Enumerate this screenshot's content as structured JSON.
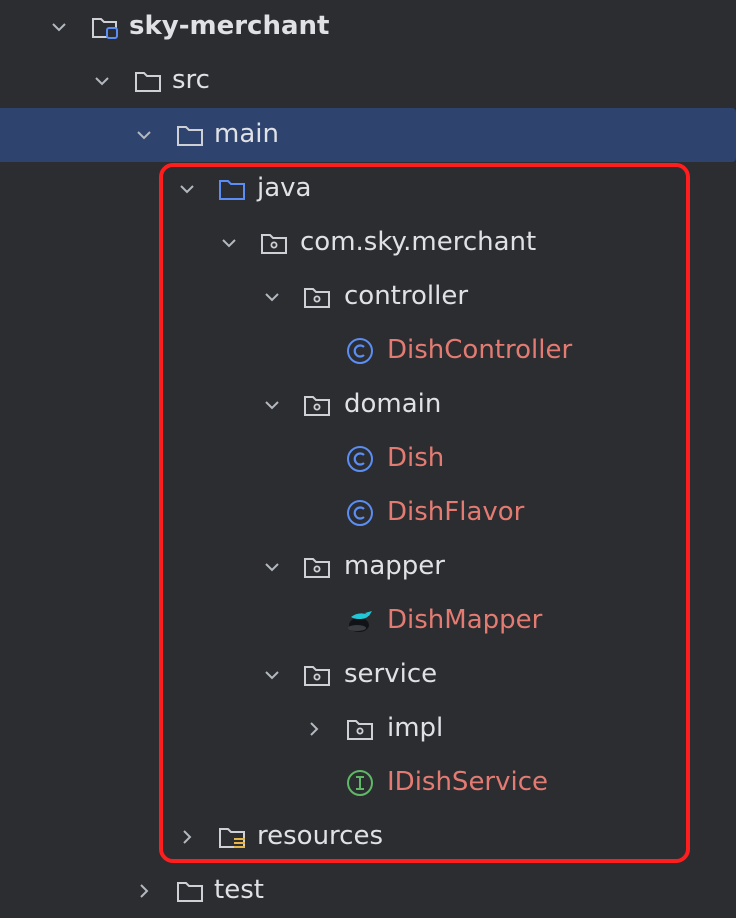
{
  "colors": {
    "background": "#2b2d30",
    "selection": "#2e436e",
    "text": "#dfe1e5",
    "modified_text": "#e37b72",
    "class_icon": "#5b8df5",
    "interface_icon": "#5fb865",
    "highlight_border": "#ff1e1e"
  },
  "tree": {
    "root": {
      "label": "sky-merchant",
      "icon": "module-folder-icon",
      "expanded": true
    },
    "src": {
      "label": "src",
      "icon": "folder-icon",
      "expanded": true
    },
    "main": {
      "label": "main",
      "icon": "folder-icon",
      "expanded": true,
      "selected": true
    },
    "java": {
      "label": "java",
      "icon": "source-root-folder-icon",
      "expanded": true
    },
    "pkg_root": {
      "label": "com.sky.merchant",
      "icon": "package-icon",
      "expanded": true
    },
    "controller": {
      "label": "controller",
      "icon": "package-icon",
      "expanded": true
    },
    "dish_controller": {
      "label": "DishController",
      "icon": "java-class-icon"
    },
    "domain": {
      "label": "domain",
      "icon": "package-icon",
      "expanded": true
    },
    "dish": {
      "label": "Dish",
      "icon": "java-class-icon"
    },
    "dish_flavor": {
      "label": "DishFlavor",
      "icon": "java-class-icon"
    },
    "mapper": {
      "label": "mapper",
      "icon": "package-icon",
      "expanded": true
    },
    "dish_mapper": {
      "label": "DishMapper",
      "icon": "mybatis-mapper-icon"
    },
    "service": {
      "label": "service",
      "icon": "package-icon",
      "expanded": true
    },
    "impl": {
      "label": "impl",
      "icon": "package-icon",
      "expanded": false
    },
    "idish_service": {
      "label": "IDishService",
      "icon": "java-interface-icon"
    },
    "resources": {
      "label": "resources",
      "icon": "resources-folder-icon",
      "expanded": false
    },
    "test": {
      "label": "test",
      "icon": "folder-icon",
      "expanded": false
    }
  }
}
